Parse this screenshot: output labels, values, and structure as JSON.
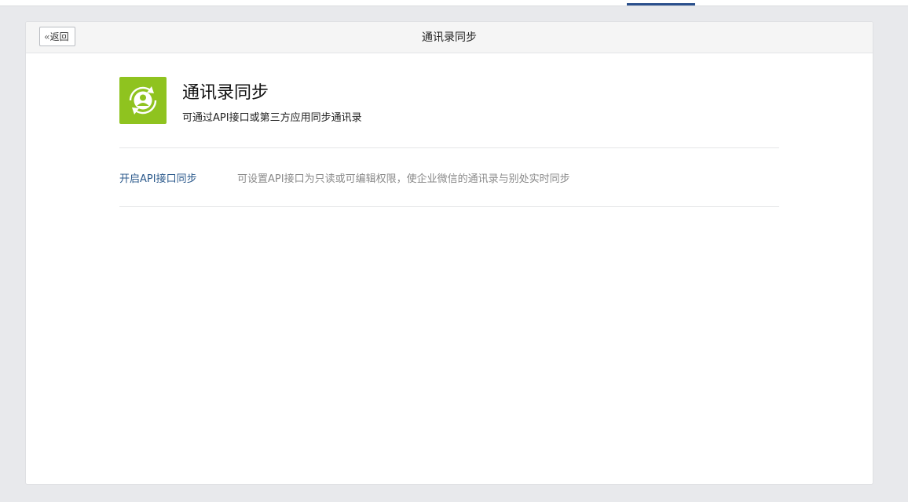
{
  "header": {
    "back_label": "返回",
    "title": "通讯录同步"
  },
  "intro": {
    "icon": "contact-sync-icon",
    "icon_color": "#8fc31f",
    "title": "通讯录同步",
    "description": "可通过API接口或第三方应用同步通讯录"
  },
  "options": [
    {
      "label": "开启API接口同步",
      "description": "可设置API接口为只读或可编辑权限，使企业微信的通讯录与别处实时同步"
    }
  ],
  "colors": {
    "accent": "#2a4f8c",
    "link": "#2c5a8c"
  }
}
